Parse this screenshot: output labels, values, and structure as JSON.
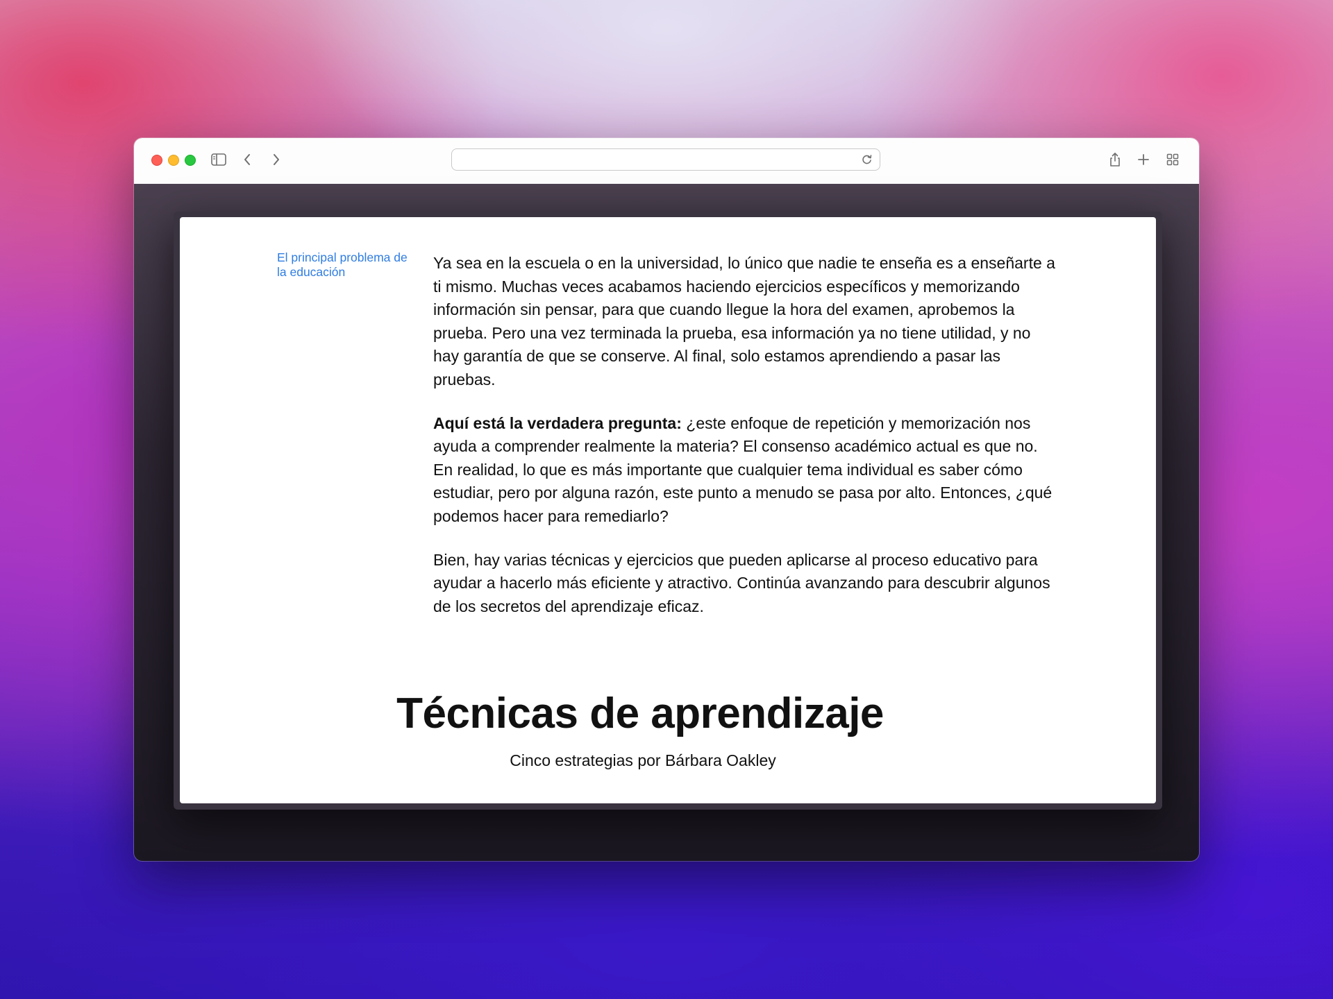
{
  "browser": {
    "address_bar": "",
    "icons": {
      "sidebar": "sidebar-icon",
      "back": "back-chevron-icon",
      "forward": "forward-chevron-icon",
      "reload": "reload-icon",
      "share": "share-icon",
      "new_tab": "plus-icon",
      "tab_overview": "tab-grid-icon"
    }
  },
  "page": {
    "side_link": "El principal problema de la educación",
    "paragraphs": [
      {
        "bold": "",
        "text": "Ya sea en la escuela o en la universidad, lo único que nadie te enseña es a enseñarte a ti mismo. Muchas veces acabamos haciendo ejercicios específicos y memorizando información sin pensar, para que cuando llegue la hora del examen, aprobemos la prueba. Pero una vez terminada la prueba, esa información ya no tiene utilidad, y no hay garantía de que se conserve. Al final, solo estamos aprendiendo a pasar las pruebas."
      },
      {
        "bold": "Aquí está la verdadera pregunta:",
        "text": " ¿este enfoque de repetición y memorización nos ayuda a comprender realmente la materia? El consenso académico actual es que no. En realidad, lo que es más importante que cualquier tema individual es saber cómo estudiar, pero por alguna razón, este punto a menudo se pasa por alto. Entonces, ¿qué podemos hacer para remediarlo?"
      },
      {
        "bold": "",
        "text": "Bien, hay varias técnicas y ejercicios que pueden aplicarse al proceso educativo para ayudar a hacerlo más eficiente y atractivo. Continúa avanzando para descubrir algunos de los secretos del aprendizaje eficaz."
      }
    ],
    "heading": "Técnicas de aprendizaje",
    "subheading": "Cinco estrategias por Bárbara Oakley"
  },
  "colors": {
    "link": "#2f7de1",
    "text": "#111111",
    "close": "#fe5f57",
    "minimize": "#febc2e",
    "zoom": "#28c840"
  }
}
